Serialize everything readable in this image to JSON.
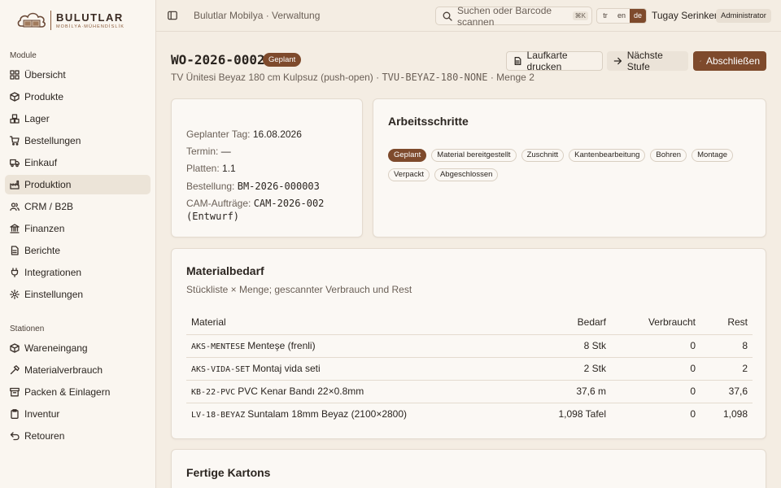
{
  "brand": {
    "name": "BULUTLAR",
    "tagline": "MOBİLYA·MÜHENDİSLİK"
  },
  "sidebar": {
    "modules_title": "Module",
    "modules": [
      {
        "label": "Übersicht",
        "icon": "grid-icon"
      },
      {
        "label": "Produkte",
        "icon": "box-icon"
      },
      {
        "label": "Lager",
        "icon": "boxes-icon"
      },
      {
        "label": "Bestellungen",
        "icon": "cart-icon"
      },
      {
        "label": "Einkauf",
        "icon": "truck-icon"
      },
      {
        "label": "Produktion",
        "icon": "factory-icon",
        "active": true
      },
      {
        "label": "CRM / B2B",
        "icon": "users-icon"
      },
      {
        "label": "Finanzen",
        "icon": "bank-icon"
      },
      {
        "label": "Berichte",
        "icon": "file-icon"
      },
      {
        "label": "Integrationen",
        "icon": "plug-icon"
      },
      {
        "label": "Einstellungen",
        "icon": "gear-icon"
      }
    ],
    "stations_title": "Stationen",
    "stations": [
      {
        "label": "Wareneingang",
        "icon": "package-in-icon"
      },
      {
        "label": "Materialverbrauch",
        "icon": "hammer-icon"
      },
      {
        "label": "Packen & Einlagern",
        "icon": "archive-icon"
      },
      {
        "label": "Inventur",
        "icon": "clipboard-icon"
      },
      {
        "label": "Retouren",
        "icon": "return-icon"
      }
    ]
  },
  "header": {
    "breadcrumb": "Bulutlar Mobilya · Verwaltung",
    "search_placeholder": "Suchen oder Barcode scannen",
    "search_shortcut": "⌘K",
    "languages": [
      "tr",
      "en",
      "de"
    ],
    "active_language": "de",
    "user_name": "Tugay Serinken",
    "user_role": "Administrator"
  },
  "work_order": {
    "id": "WO-2026-0002",
    "status": "Geplant",
    "product_name": "TV Ünitesi Beyaz 180 cm Kulpsuz (push-open) · ",
    "sku": "TVU-BEYAZ-180-NONE",
    "quantity_text": " · Menge 2"
  },
  "actions": {
    "print_label": "Laufkarte drucken",
    "next_label": "Nächste Stufe",
    "complete_label": "Abschließen"
  },
  "info": {
    "planned_day_label": "Geplanter Tag: ",
    "planned_day_value": "16.08.2026",
    "deadline_label": "Termin: ",
    "deadline_value": "—",
    "boards_label": "Platten: ",
    "boards_value": "1.1",
    "order_label": "Bestellung: ",
    "order_value": "BM-2026-000003",
    "cam_label": "CAM-Aufträge: ",
    "cam_value": "CAM-2026-002 (Entwurf)"
  },
  "steps": {
    "title": "Arbeitsschritte",
    "items": [
      "Geplant",
      "Material bereitgestellt",
      "Zuschnitt",
      "Kantenbearbeitung",
      "Bohren",
      "Montage",
      "Verpackt",
      "Abgeschlossen"
    ],
    "active_index": 0
  },
  "materials": {
    "title": "Materialbedarf",
    "description": "Stückliste × Menge; gescannter Verbrauch und Rest",
    "columns": [
      "Material",
      "Bedarf",
      "Verbraucht",
      "Rest"
    ],
    "rows": [
      {
        "code": "AKS-MENTESE",
        "name": "Menteşe (frenli)",
        "need": "8 Stk",
        "used": "0",
        "rest": "8"
      },
      {
        "code": "AKS-VIDA-SET",
        "name": "Montaj vida seti",
        "need": "2 Stk",
        "used": "0",
        "rest": "2"
      },
      {
        "code": "KB-22-PVC",
        "name": "PVC Kenar Bandı 22×0.8mm",
        "need": "37,6 m",
        "used": "0",
        "rest": "37,6"
      },
      {
        "code": "LV-18-BEYAZ",
        "name": "Suntalam 18mm Beyaz (2100×2800)",
        "need": "1,098 Tafel",
        "used": "0",
        "rest": "1,098"
      }
    ]
  },
  "boxes": {
    "title": "Fertige Kartons"
  },
  "colors": {
    "accent": "#7e4a2c",
    "background": "#f4ede3",
    "card": "#fbf8f4",
    "sidebar": "#faf6f0"
  }
}
